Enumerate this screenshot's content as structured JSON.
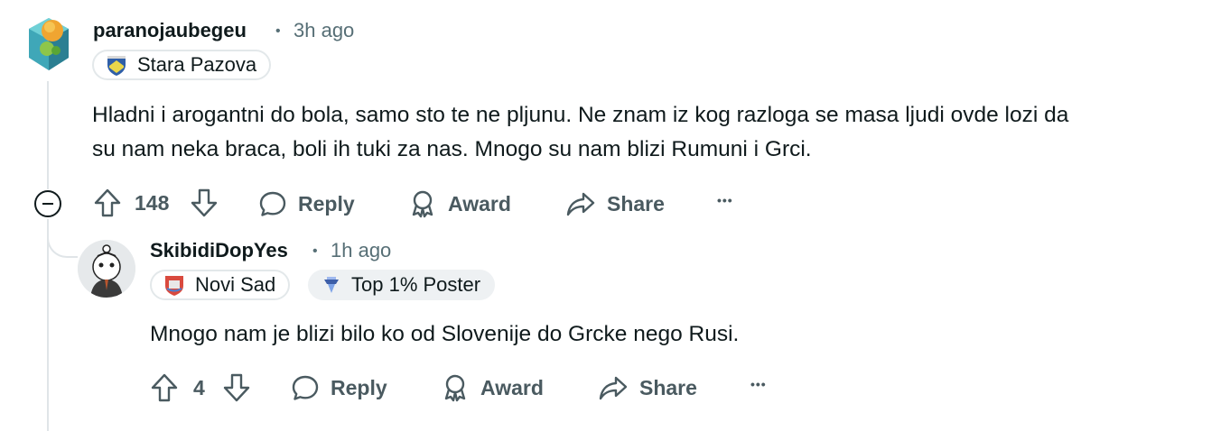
{
  "comments": [
    {
      "username": "paranojaubegeu",
      "separator": "•",
      "time": "3h ago",
      "flairs": [
        {
          "label": "Stara Pazova",
          "icon": "coat-of-arms-icon"
        }
      ],
      "body": "Hladni i arogantni do bola, samo sto te ne pljunu. Ne znam iz kog razloga se masa ljudi ovde lozi da su nam neka braca, boli ih tuki za nas. Mnogo su nam blizi Rumuni i Grci.",
      "votes": "148",
      "actions": {
        "reply": "Reply",
        "award": "Award",
        "share": "Share",
        "more": "•••"
      }
    },
    {
      "username": "SkibidiDopYes",
      "separator": "•",
      "time": "1h ago",
      "flairs": [
        {
          "label": "Novi Sad",
          "icon": "novi-sad-crest-icon"
        },
        {
          "label": "Top 1% Poster",
          "icon": "top-poster-icon"
        }
      ],
      "body": "Mnogo nam je blizi bilo ko od Slovenije do Grcke nego Rusi.",
      "votes": "4",
      "actions": {
        "reply": "Reply",
        "award": "Award",
        "share": "Share",
        "more": "•••"
      }
    }
  ],
  "colors": {
    "text": "#0f1a1c",
    "meta": "#576f76",
    "action": "#4a5a60",
    "thread": "#e0e5e8"
  }
}
